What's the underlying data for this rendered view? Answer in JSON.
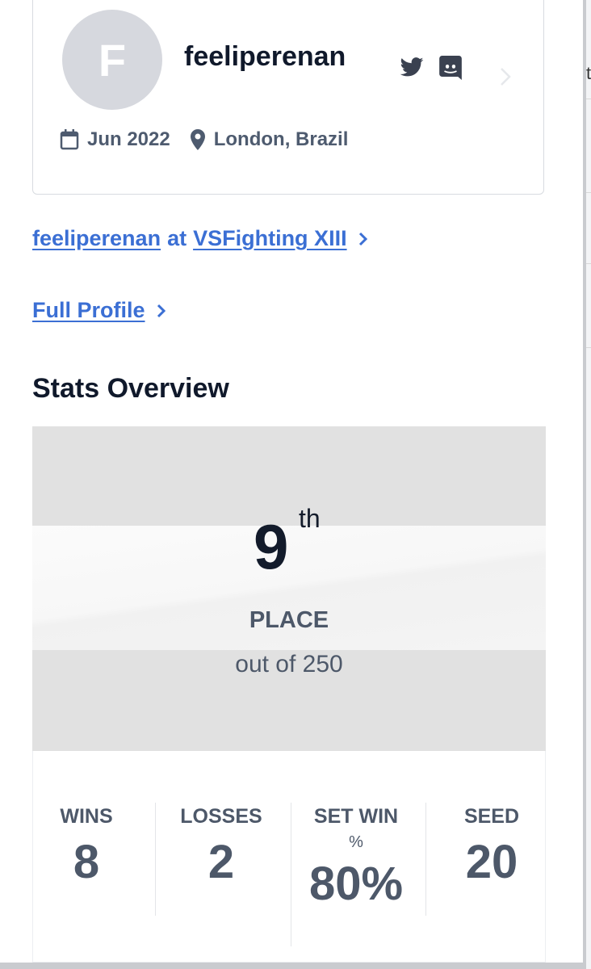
{
  "profile": {
    "avatar_letter": "F",
    "username": "feeliperenan",
    "join_date": "Jun 2022",
    "location": "London, Brazil",
    "icons": [
      "twitter-icon",
      "discord-icon",
      "calendar-icon",
      "location-pin-icon",
      "chevron-right-icon"
    ]
  },
  "links": {
    "event_user": "feeliperenan",
    "event_at": "at",
    "event_name": "VSFighting XIII",
    "full_profile": "Full Profile"
  },
  "stats": {
    "title": "Stats Overview",
    "placement": {
      "number": "9",
      "suffix": "th",
      "label": "PLACE",
      "total": "out of 250"
    },
    "wins": {
      "label": "WINS",
      "value": "8"
    },
    "losses": {
      "label": "LOSSES",
      "value": "2"
    },
    "set_win": {
      "label": "SET WIN",
      "label_sub": "%",
      "value": "80%"
    },
    "seed": {
      "label": "SEED",
      "value": "20"
    }
  },
  "colors": {
    "link": "#3b6fd4",
    "text_dark": "#10192b",
    "text_muted": "#4d5869",
    "placement_bg": "#e1e1e1"
  }
}
